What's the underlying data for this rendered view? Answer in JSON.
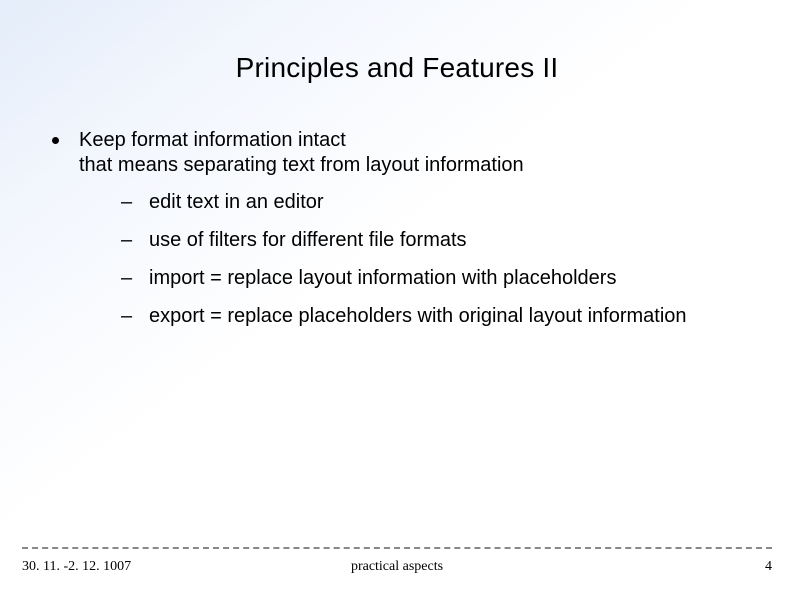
{
  "title": "Principles and Features II",
  "bullets": [
    {
      "text": "Keep format information intact\nthat means separating text from layout information",
      "sub": [
        "edit text in an editor",
        "use of filters for different file formats",
        "import = replace layout information with placeholders",
        "export = replace placeholders with original layout information"
      ]
    }
  ],
  "footer": {
    "date": "30. 11. -2. 12. 1007",
    "subject": "practical aspects",
    "page": "4"
  }
}
